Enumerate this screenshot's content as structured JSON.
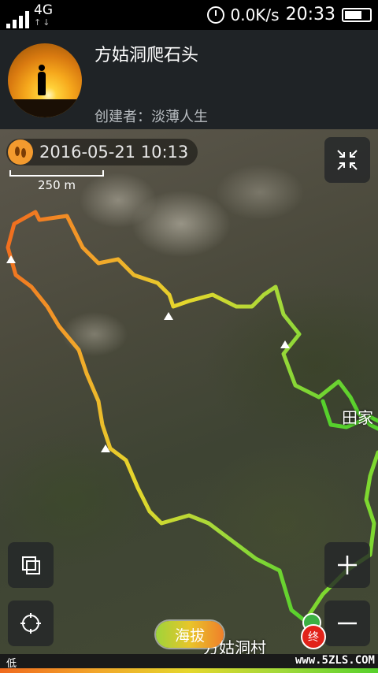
{
  "status_bar": {
    "network": "4G",
    "network_arrows": "↑↓",
    "speed": "0.0K/s",
    "time": "20:33",
    "battery_level": 0.7
  },
  "header": {
    "title": "方姑洞爬石头",
    "creator": "创建者：淡薄人生"
  },
  "map": {
    "timestamp": "2016-05-21 10:13",
    "scale_label": "250 m",
    "village_labels": [
      "田家",
      "方姑洞村"
    ],
    "elevation_button": "海拔",
    "end_marker": "终",
    "route_colors": [
      "#f06a1e",
      "#f2a52a",
      "#e5d72c",
      "#9fd93a",
      "#56d12c"
    ]
  },
  "legend": {
    "low_label": "低"
  },
  "watermark": "www.5ZLS.COM"
}
